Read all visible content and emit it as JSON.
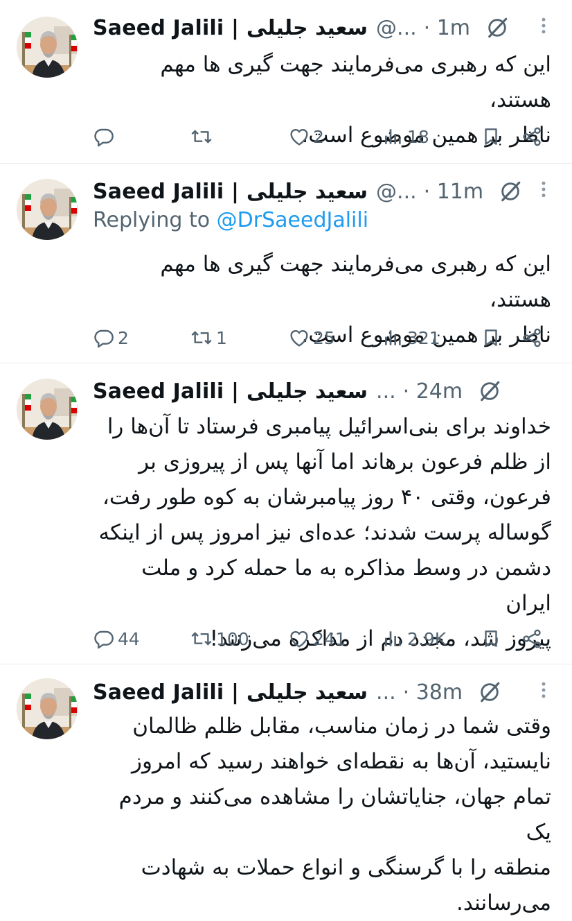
{
  "tweets": [
    {
      "name": "Saeed Jalili | سعید جلیلی",
      "handle": "@...",
      "time": "· 1m",
      "reply_prefix": "",
      "reply_to": "",
      "lines": [
        "این که رهبری می‌فرمایند جهت گیری ها مهم هستند،",
        "ناظر بر همین موضوع است."
      ],
      "replies": "",
      "retweets": "",
      "likes": "2",
      "views": "18"
    },
    {
      "name": "Saeed Jalili | سعید جلیلی",
      "handle": "@...",
      "time": "· 11m",
      "reply_prefix": "Replying to ",
      "reply_to": "@DrSaeedJalili",
      "lines": [
        "این که رهبری می‌فرمایند جهت گیری ها مهم هستند،",
        "ناظر بر همین موضوع است."
      ],
      "replies": "2",
      "retweets": "1",
      "likes": "25",
      "views": "321"
    },
    {
      "name": "Saeed Jalili | سعید جلیلی",
      "handle": "...",
      "time": "· 24m",
      "reply_prefix": "",
      "reply_to": "",
      "lines": [
        "خداوند برای بنی‌اسرائیل پیامبری فرستاد تا آن‌ها را",
        "از ظلم فرعون برهاند اما آنها پس از پیروزی بر",
        "فرعون، وقتی ۴۰ روز پیامبرشان به کوه طور رفت،",
        "گوساله پرست شدند؛ عده‌ای نیز امروز پس از اینکه",
        "دشمن در وسط مذاکره به ما حمله کرد و ملت ایران",
        "پیروز شد، مجدد دم از مذاکره می‌زنند!"
      ],
      "replies": "44",
      "retweets": "100",
      "likes": "241",
      "views": "2.9K"
    },
    {
      "name": "Saeed Jalili | سعید جلیلی",
      "handle": "...",
      "time": "· 38m",
      "reply_prefix": "",
      "reply_to": "",
      "lines": [
        "وقتی شما در زمان مناسب، مقابل ظلم ظالمان",
        "نایستید، آن‌ها به نقطه‌ای خواهند رسید که امروز",
        "تمام جهان، جنایاتشان را مشاهده می‌کنند و مردم یک",
        "منطقه را با گرسنگی و انواع حملات به شهادت",
        "می‌رسانند."
      ],
      "replies": "",
      "retweets": "",
      "likes": "",
      "views": ""
    }
  ],
  "icons": {
    "reply": "reply-icon",
    "retweet": "retweet-icon",
    "like": "heart-icon",
    "views": "views-icon",
    "bookmark": "bookmark-icon",
    "share": "share-icon",
    "grok": "grok-icon",
    "more": "more-icon"
  },
  "colors": {
    "text": "#0f1419",
    "secondary": "#536471",
    "link": "#1d9bf0",
    "divider": "#e6ecf0"
  }
}
